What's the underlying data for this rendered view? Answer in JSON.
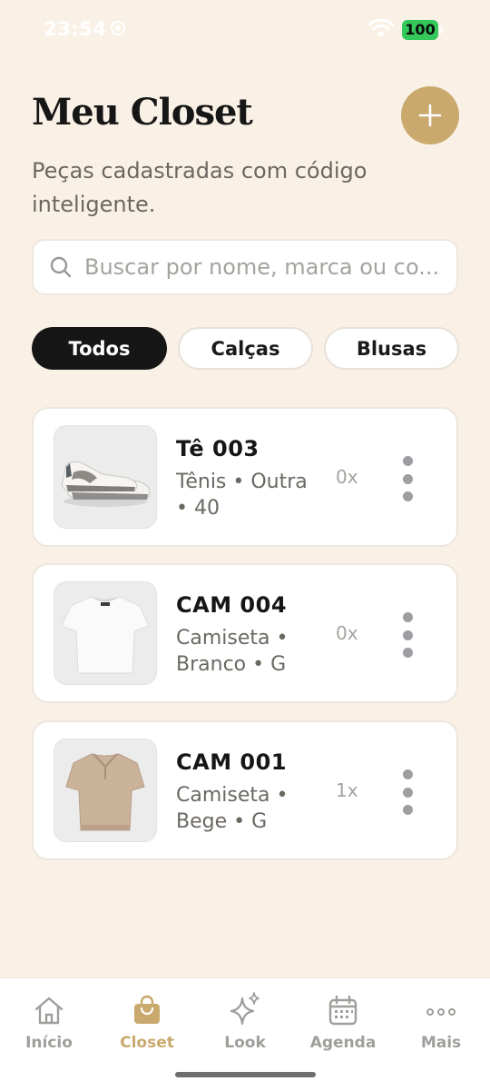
{
  "status_bar": {
    "time": "23:54",
    "battery": "100"
  },
  "header": {
    "title": "Meu Closet",
    "subtitle": "Peças cadastradas com código inteligente.",
    "add_icon": "plus-icon"
  },
  "search": {
    "placeholder": "Buscar por nome, marca ou co...",
    "value": "",
    "icon": "search-icon"
  },
  "filters": [
    {
      "label": "Todos",
      "active": true
    },
    {
      "label": "Calças",
      "active": false
    },
    {
      "label": "Blusas",
      "active": false
    }
  ],
  "items": [
    {
      "name": "Tê 003",
      "meta": "Tênis • Outra • 40",
      "count": "0x",
      "image": "sneaker-image"
    },
    {
      "name": "CAM 004",
      "meta": "Camiseta • Branco • G",
      "count": "0x",
      "image": "white-tshirt-image"
    },
    {
      "name": "CAM 001",
      "meta": "Camiseta • Bege • G",
      "count": "1x",
      "image": "beige-polo-image"
    }
  ],
  "tabbar": [
    {
      "label": "Início",
      "icon": "home-icon",
      "active": false
    },
    {
      "label": "Closet",
      "icon": "bag-icon",
      "active": true
    },
    {
      "label": "Look",
      "icon": "sparkles-icon",
      "active": false
    },
    {
      "label": "Agenda",
      "icon": "calendar-icon",
      "active": false
    },
    {
      "label": "Mais",
      "icon": "more-icon",
      "active": false
    }
  ],
  "colors": {
    "background": "#faf1e6",
    "accent": "#c9a96d",
    "active_chip": "#161616",
    "battery": "#34c759"
  }
}
